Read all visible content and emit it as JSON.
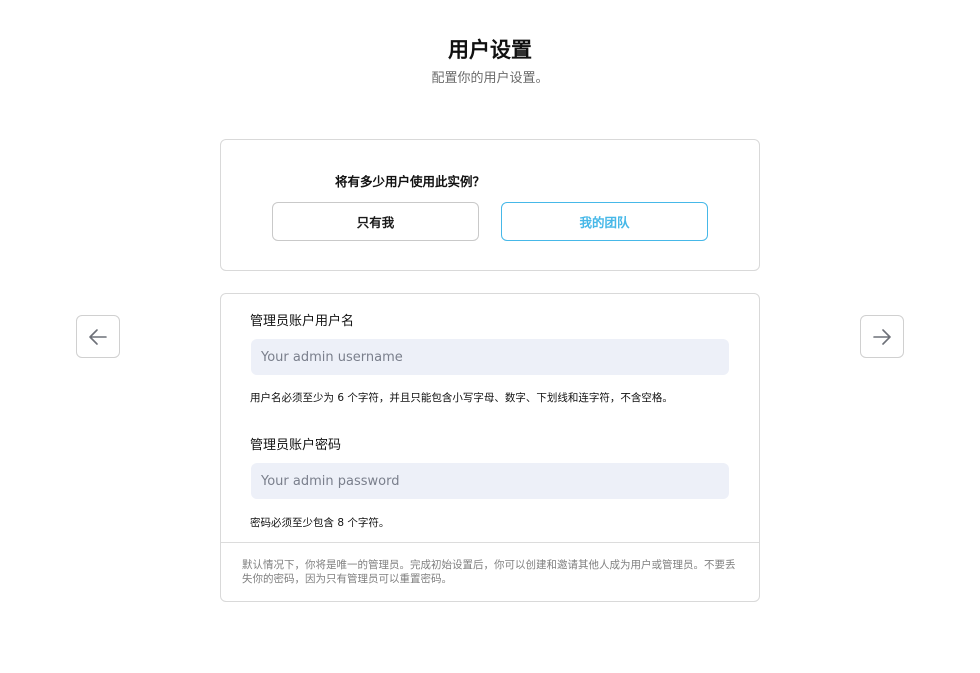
{
  "header": {
    "title": "用户设置",
    "subtitle": "配置你的用户设置。"
  },
  "users_card": {
    "question": "将有多少用户使用此实例？",
    "options": [
      {
        "label": "只有我",
        "selected": false
      },
      {
        "label": "我的团队",
        "selected": true
      }
    ],
    "accent_color": "#46b8e8"
  },
  "form": {
    "username": {
      "label": "管理员账户用户名",
      "placeholder": "Your admin username",
      "value": "",
      "hint": "用户名必须至少为 6 个字符，并且只能包含小写字母、数字、下划线和连字符，不含空格。"
    },
    "password": {
      "label": "管理员账户密码",
      "placeholder": "Your admin password",
      "value": "",
      "hint": "密码必须至少包含 8 个字符。"
    },
    "footnote": "默认情况下，你将是唯一的管理员。完成初始设置后，你可以创建和邀请其他人成为用户或管理员。不要丢失你的密码，因为只有管理员可以重置密码。"
  },
  "navigation": {
    "prev_icon": "arrow-left-icon",
    "next_icon": "arrow-right-icon"
  }
}
